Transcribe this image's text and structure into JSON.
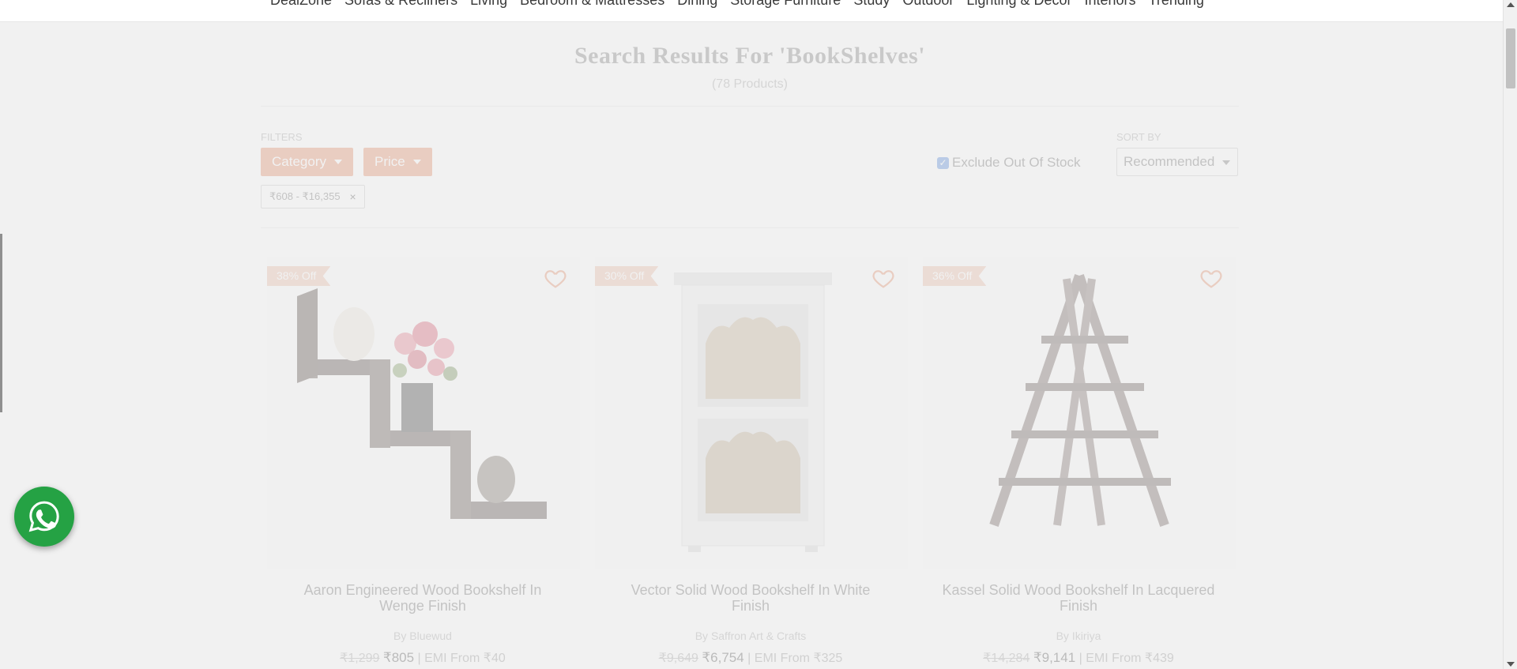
{
  "nav": {
    "items": [
      "DealZone",
      "Sofas & Recliners",
      "Living",
      "Bedroom & Mattresses",
      "Dining",
      "Storage Furniture",
      "Study",
      "Outdoor",
      "Lighting & Decor",
      "Interiors",
      "Trending"
    ]
  },
  "search": {
    "title": "Search Results For 'BookShelves'",
    "count": "(78 Products)"
  },
  "filters": {
    "label": "FILTERS",
    "category_label": "Category",
    "price_label": "Price",
    "active_chip": "₹608 - ₹16,355",
    "chip_close": "×",
    "exclude_oos_label": "Exclude Out Of Stock",
    "exclude_oos_checked": true
  },
  "sort": {
    "label": "SORT BY",
    "selected": "Recommended"
  },
  "products": [
    {
      "discount": "38% Off",
      "name": "Aaron Engineered Wood Bookshelf In Wenge Finish",
      "brand_prefix": "By",
      "brand": "Bluewud",
      "old_price": "₹1,299",
      "new_price": "₹805",
      "emi": "| EMI From ₹40"
    },
    {
      "discount": "30% Off",
      "name": "Vector Solid Wood Bookshelf In White Finish",
      "brand_prefix": "By",
      "brand": "Saffron Art & Crafts",
      "old_price": "₹9,649",
      "new_price": "₹6,754",
      "emi": "| EMI From ₹325"
    },
    {
      "discount": "36% Off",
      "name": "Kassel Solid Wood Bookshelf In Lacquered Finish",
      "brand_prefix": "By",
      "brand": "Ikiriya",
      "old_price": "₹14,284",
      "new_price": "₹9,141",
      "emi": "| EMI From ₹439"
    }
  ],
  "colors": {
    "accent": "#e37d55",
    "badge": "#e8b39c",
    "whatsapp": "#25a244",
    "overlay": "#ececec"
  },
  "icons": {
    "wishlist": "heart-outline-icon",
    "whatsapp": "whatsapp-icon",
    "dropdown": "caret-down-icon",
    "remove": "close-icon"
  }
}
